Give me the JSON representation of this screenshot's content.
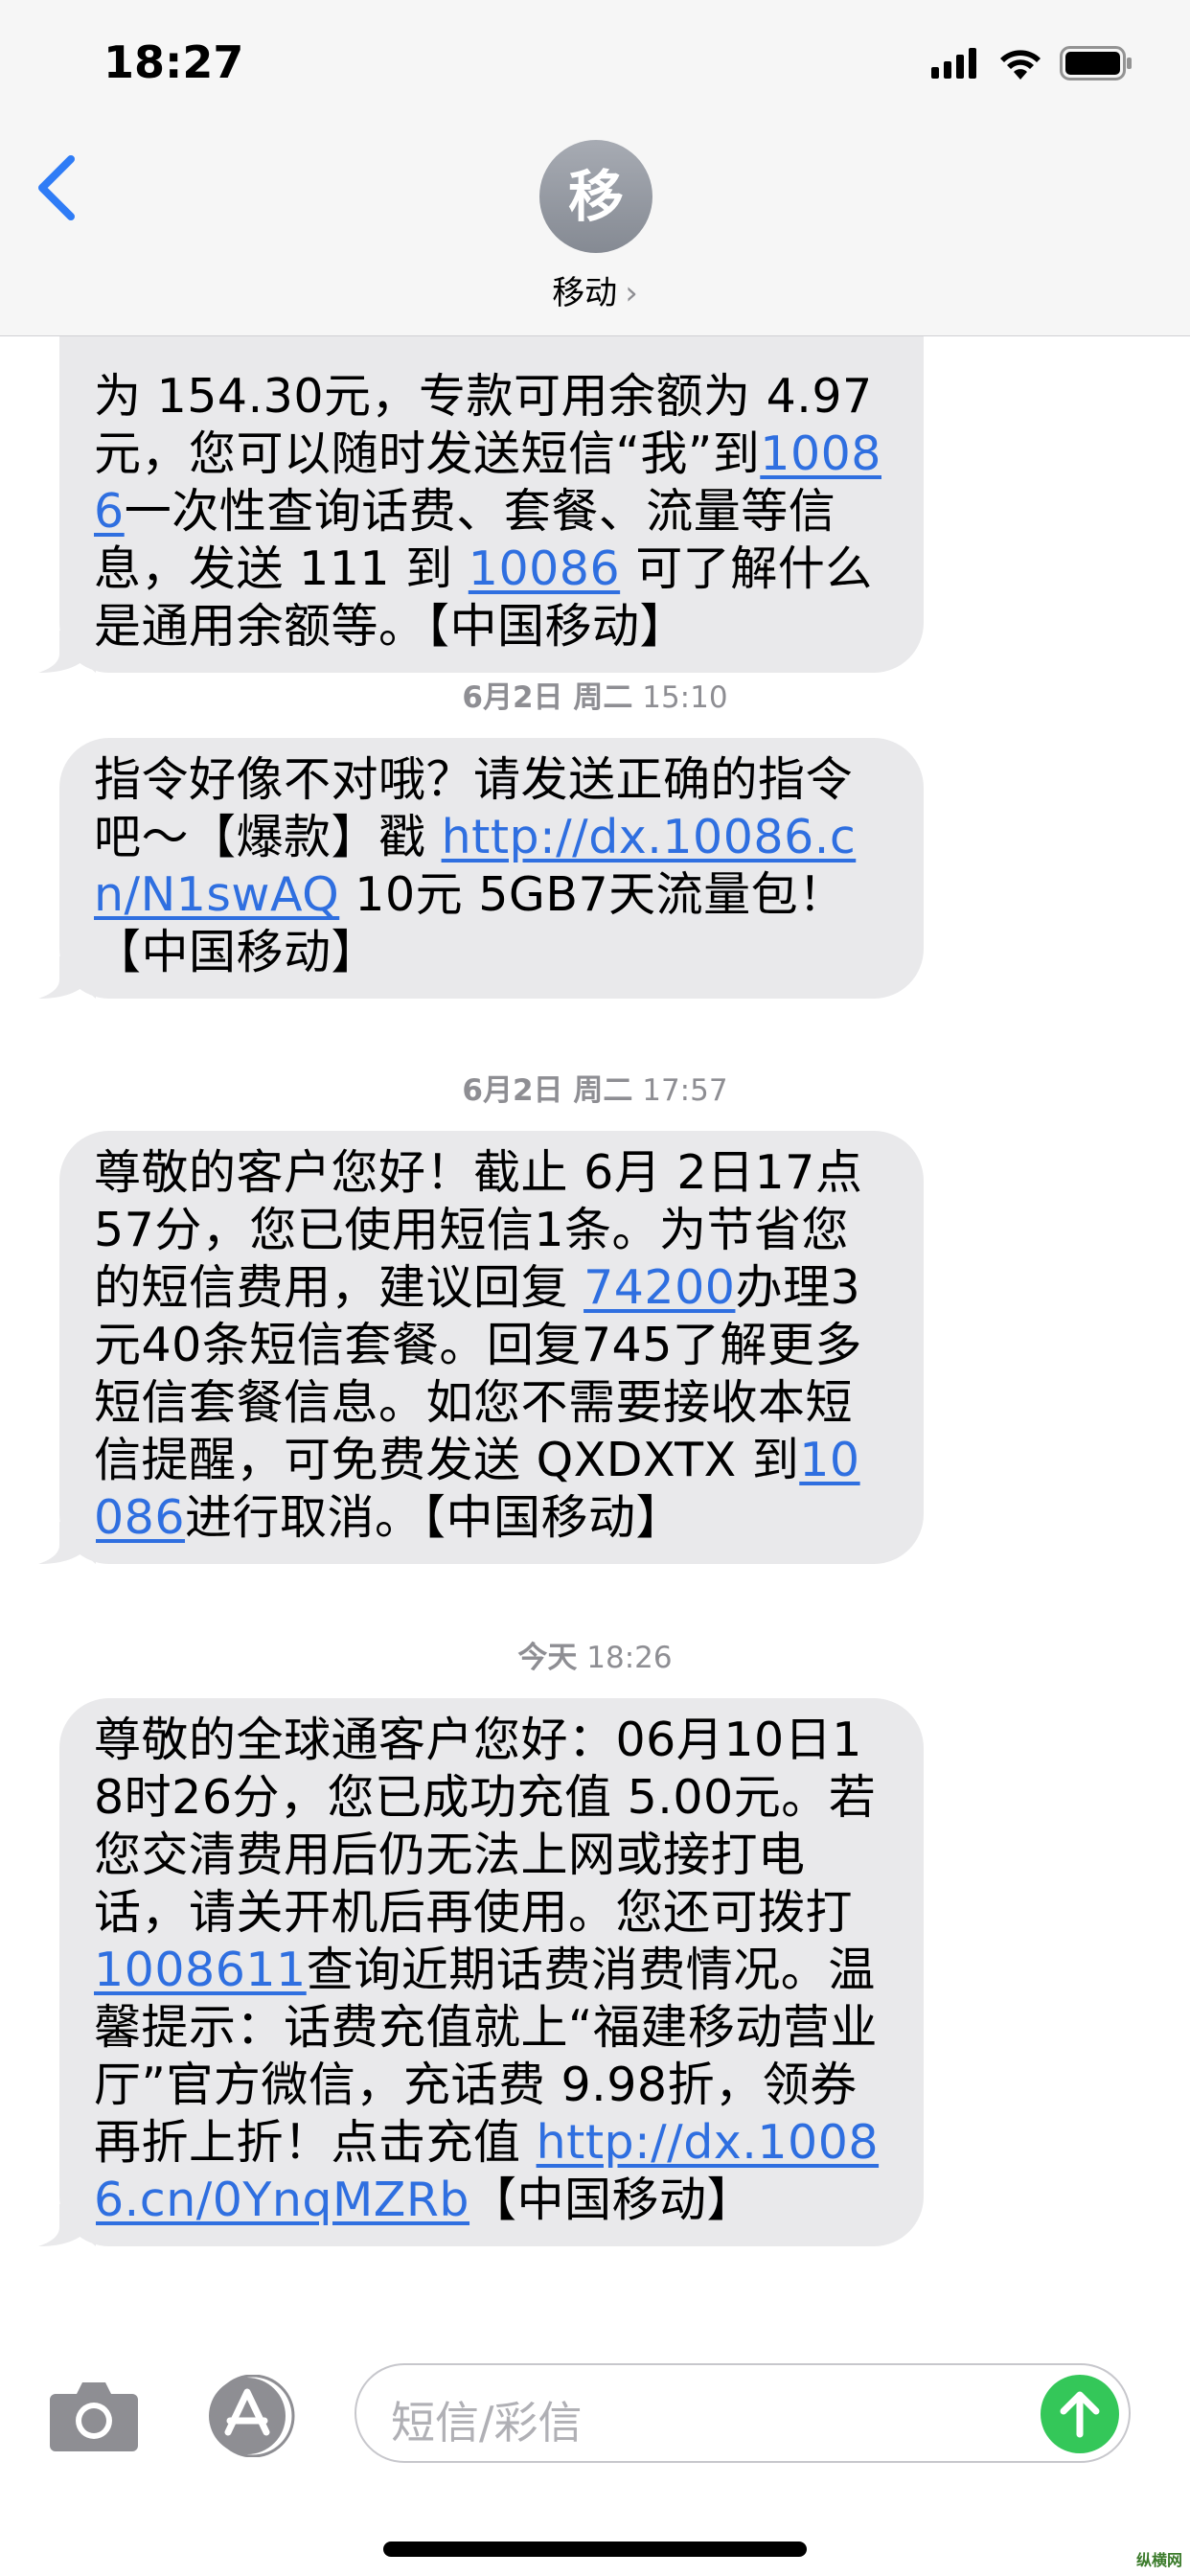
{
  "status_bar": {
    "time": "18:27"
  },
  "header": {
    "avatar_letter": "移",
    "contact_name": "移动",
    "chevron": "›"
  },
  "messages": [
    {
      "segments": [
        {
          "text": "为 154.30元，专款可用余额为 4.97元，您可以随时发送短信“我”到"
        },
        {
          "text": "10086",
          "link": true
        },
        {
          "text": "一次性查询话费、套餐、流量等信息，发送 111 到 "
        },
        {
          "text": "10086",
          "link": true
        },
        {
          "text": " 可了解什么是通用余额等。【中国移动】"
        }
      ]
    },
    {
      "timestamp": {
        "date": "6月2日 周二",
        "time": "15:10"
      },
      "segments": [
        {
          "text": "指令好像不对哦？请发送正确的指令吧～【爆款】戳 "
        },
        {
          "text": "http://dx.10086.cn/N1swAQ",
          "link": true
        },
        {
          "text": " 10元 5GB7天流量包！【中国移动】"
        }
      ]
    },
    {
      "timestamp": {
        "date": "6月2日 周二",
        "time": "17:57"
      },
      "segments": [
        {
          "text": "尊敬的客户您好！截止 6月 2日17点57分，您已使用短信1条。为节省您的短信费用，建议回复 "
        },
        {
          "text": "74200",
          "link": true
        },
        {
          "text": "办理3元40条短信套餐。回复745了解更多短信套餐信息。如您不需要接收本短信提醒，可免费发送 QXDXTX 到"
        },
        {
          "text": "10086",
          "link": true
        },
        {
          "text": "进行取消。【中国移动】"
        }
      ]
    },
    {
      "timestamp": {
        "date": "今天",
        "time": "18:26"
      },
      "segments": [
        {
          "text": "尊敬的全球通客户您好：06月10日18时26分，您已成功充值 5.00元。若您交清费用后仍无法上网或接打电话，请关开机后再使用。您还可拨打 "
        },
        {
          "text": "1008611",
          "link": true
        },
        {
          "text": "查询近期话费消费情况。温馨提示：话费充值就上“福建移动营业厅”官方微信，充话费 9.98折，领券再折上折！点击充值 "
        },
        {
          "text": "http://dx.10086.cn/0YnqMZRb",
          "link": true
        },
        {
          "text": "【中国移动】"
        }
      ]
    }
  ],
  "input_bar": {
    "placeholder": "短信/彩信"
  },
  "icons": {
    "back": "chevron-left-icon",
    "camera": "camera-icon",
    "apps": "app-store-icon",
    "send": "arrow-up-icon",
    "signal": "cellular-signal-icon",
    "wifi": "wifi-icon",
    "battery": "battery-icon"
  },
  "colors": {
    "accent": "#2f6fe0",
    "bubble": "#e9e9eb",
    "send": "#34c759",
    "meta": "#8e8e93"
  },
  "watermark": "纵横网"
}
